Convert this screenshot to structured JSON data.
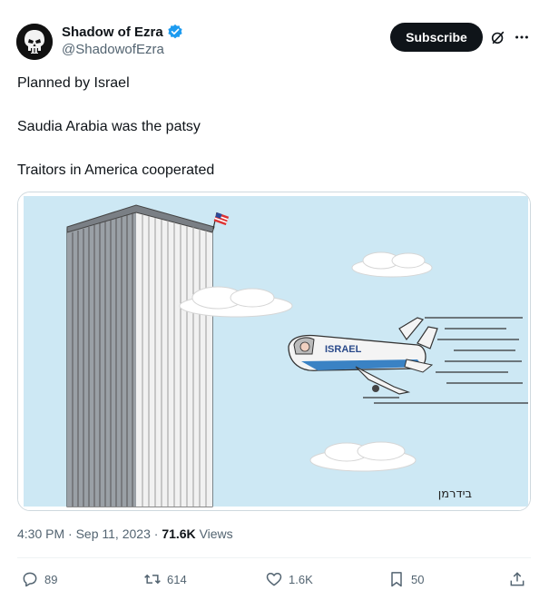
{
  "author": {
    "display_name": "Shadow of Ezra",
    "handle": "@ShadowofEzra",
    "verified": true
  },
  "header": {
    "subscribe_label": "Subscribe",
    "grok_icon": "grok-icon",
    "more_icon": "more-icon"
  },
  "tweet": {
    "lines": [
      "Planned by Israel",
      "Saudia Arabia was the patsy",
      "Traitors in America cooperated"
    ]
  },
  "media": {
    "plane_text": "ISRAEL",
    "signature_text": "בידרמן"
  },
  "meta": {
    "time": "4:30 PM",
    "separator": "·",
    "date": "Sep 11, 2023",
    "views_count": "71.6K",
    "views_label": "Views"
  },
  "actions": {
    "replies": "89",
    "reposts": "614",
    "likes": "1.6K",
    "bookmarks": "50"
  },
  "colors": {
    "accent": "#1d9bf0",
    "sky": "#cde8f4",
    "text_secondary": "#536471"
  }
}
